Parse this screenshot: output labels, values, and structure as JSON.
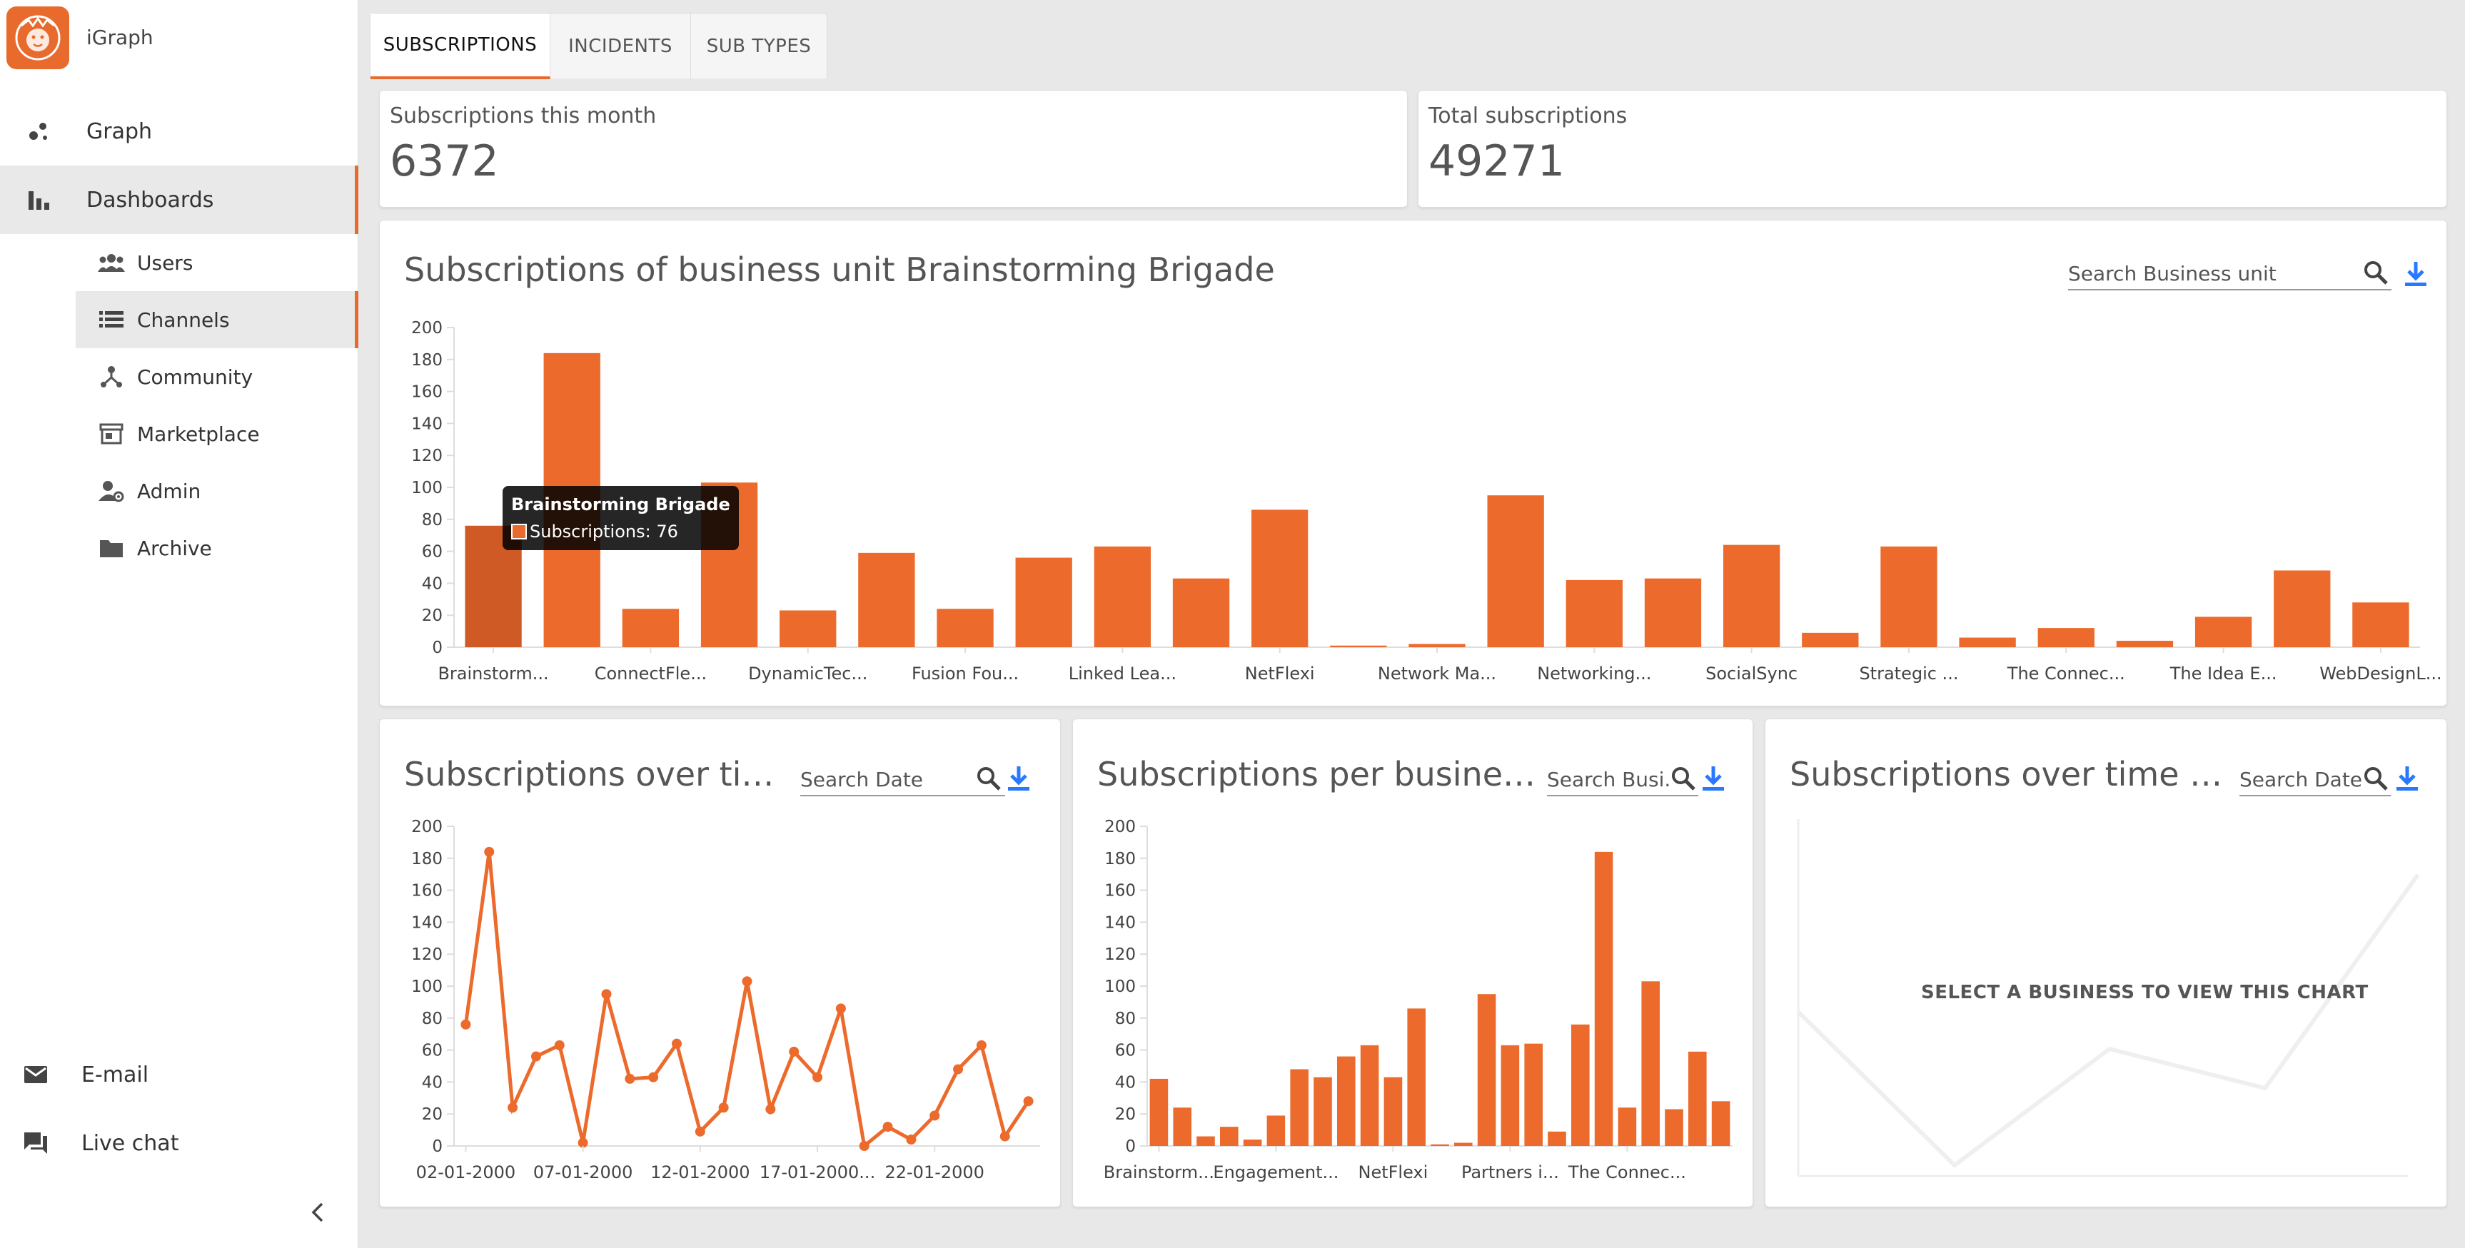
{
  "app": {
    "name": "iGraph",
    "accent": "#e86a2c"
  },
  "sidebar": {
    "items": [
      {
        "label": "Graph",
        "icon": "graph-icon"
      },
      {
        "label": "Dashboards",
        "icon": "bar-chart-icon",
        "active": true
      }
    ],
    "sub_items": [
      {
        "label": "Users",
        "icon": "users-icon"
      },
      {
        "label": "Channels",
        "icon": "list-icon",
        "active": true
      },
      {
        "label": "Community",
        "icon": "community-icon"
      },
      {
        "label": "Marketplace",
        "icon": "store-icon"
      },
      {
        "label": "Admin",
        "icon": "admin-icon"
      },
      {
        "label": "Archive",
        "icon": "folder-icon"
      }
    ],
    "footer": [
      {
        "label": "E-mail",
        "icon": "mail-icon"
      },
      {
        "label": "Live chat",
        "icon": "chat-icon"
      }
    ]
  },
  "tabs": [
    {
      "label": "SUBSCRIPTIONS",
      "active": true
    },
    {
      "label": "INCIDENTS"
    },
    {
      "label": "SUB TYPES"
    }
  ],
  "stats": {
    "month": {
      "label": "Subscriptions this month",
      "value": "6372"
    },
    "total": {
      "label": "Total subscriptions",
      "value": "49271"
    }
  },
  "business_chart": {
    "title": "Subscriptions of business unit Brainstorming Brigade",
    "search_placeholder": "Search Business unit",
    "tooltip": {
      "title": "Brainstorming Brigade",
      "text": "Subscriptions: 76"
    }
  },
  "time_chart": {
    "title": "Subscriptions over time",
    "search_placeholder": "Search Date"
  },
  "per_business_chart": {
    "title": "Subscriptions per business a...",
    "search_placeholder": "Search Busi..."
  },
  "time_business_chart": {
    "title": "Subscriptions over time of bu...",
    "search_placeholder": "Search Date",
    "empty_message": "SELECT A BUSINESS TO VIEW THIS CHART"
  },
  "chart_data": [
    {
      "type": "bar",
      "title": "Subscriptions of business unit Brainstorming Brigade",
      "xlabel": "",
      "ylabel": "",
      "ylim": [
        0,
        200
      ],
      "yticks": [
        0,
        20,
        40,
        60,
        80,
        100,
        120,
        140,
        160,
        180,
        200
      ],
      "tick_labels": [
        "Brainstorm...",
        "ConnectFle...",
        "DynamicTec...",
        "Fusion Fou...",
        "Linked Lea...",
        "NetFlexi",
        "Network Ma...",
        "Networking...",
        "SocialSync",
        "Strategic ...",
        "The Connec...",
        "The Idea E...",
        "WebDesignL..."
      ],
      "values": [
        76,
        184,
        24,
        103,
        23,
        59,
        24,
        56,
        63,
        43,
        86,
        1,
        2,
        95,
        42,
        43,
        64,
        9,
        63,
        6,
        12,
        4,
        19,
        48,
        28
      ],
      "highlight_index": 0,
      "color": "#ec6a2c",
      "highlight_color": "#cf5a26",
      "grid": false
    },
    {
      "type": "line",
      "title": "Subscriptions over time",
      "xlabel": "",
      "ylabel": "",
      "ylim": [
        0,
        200
      ],
      "yticks": [
        0,
        20,
        40,
        60,
        80,
        100,
        120,
        140,
        160,
        180,
        200
      ],
      "tick_labels": [
        "02-01-2000",
        "07-01-2000",
        "12-01-2000",
        "17-01-2000...",
        "22-01-2000"
      ],
      "values": [
        76,
        184,
        24,
        56,
        63,
        2,
        95,
        42,
        43,
        64,
        9,
        24,
        103,
        23,
        59,
        43,
        86,
        0,
        12,
        4,
        19,
        48,
        63,
        6,
        28
      ],
      "color": "#ec6a2c",
      "grid": false
    },
    {
      "type": "bar",
      "title": "Subscriptions per business a...",
      "xlabel": "",
      "ylabel": "",
      "ylim": [
        0,
        200
      ],
      "yticks": [
        0,
        20,
        40,
        60,
        80,
        100,
        120,
        140,
        160,
        180,
        200
      ],
      "tick_labels": [
        "Brainstorm...",
        "Engagement...",
        "NetFlexi",
        "Partners i...",
        "The Connec..."
      ],
      "values": [
        42,
        24,
        6,
        12,
        4,
        19,
        48,
        43,
        56,
        63,
        43,
        86,
        1,
        2,
        95,
        63,
        64,
        9,
        76,
        184,
        24,
        103,
        23,
        59,
        28
      ],
      "color": "#ec6a2c",
      "grid": false
    }
  ]
}
